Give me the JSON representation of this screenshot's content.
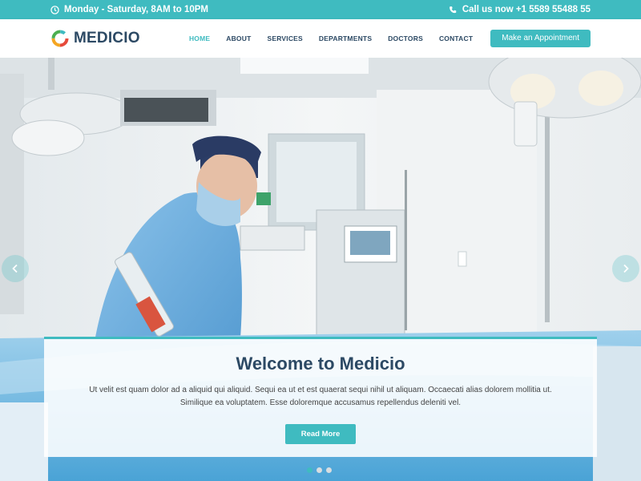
{
  "topbar": {
    "hours": "Monday - Saturday, 8AM to 10PM",
    "phone": "Call us now +1 5589 55488 55"
  },
  "header": {
    "brand": "MEDICIO",
    "nav": [
      {
        "label": "HOME",
        "active": true
      },
      {
        "label": "ABOUT"
      },
      {
        "label": "SERVICES"
      },
      {
        "label": "DEPARTMENTS"
      },
      {
        "label": "DOCTORS"
      },
      {
        "label": "CONTACT"
      }
    ],
    "cta_label": "Make an Appointment"
  },
  "hero": {
    "title": "Welcome to Medicio",
    "text": "Ut velit est quam dolor ad a aliquid qui aliquid. Sequi ea ut et est quaerat sequi nihil ut aliquam. Occaecati alias dolorem mollitia ut. Similique ea voluptatem. Esse doloremque accusamus repellendus deleniti vel.",
    "button_label": "Read More",
    "slides": 3,
    "active_slide": 1
  },
  "colors": {
    "accent": "#3fbbc0",
    "heading": "#2c4964"
  },
  "icons": {
    "hours": "clock-icon",
    "phone": "phone-icon",
    "prev": "chevron-left-icon",
    "next": "chevron-right-icon"
  }
}
